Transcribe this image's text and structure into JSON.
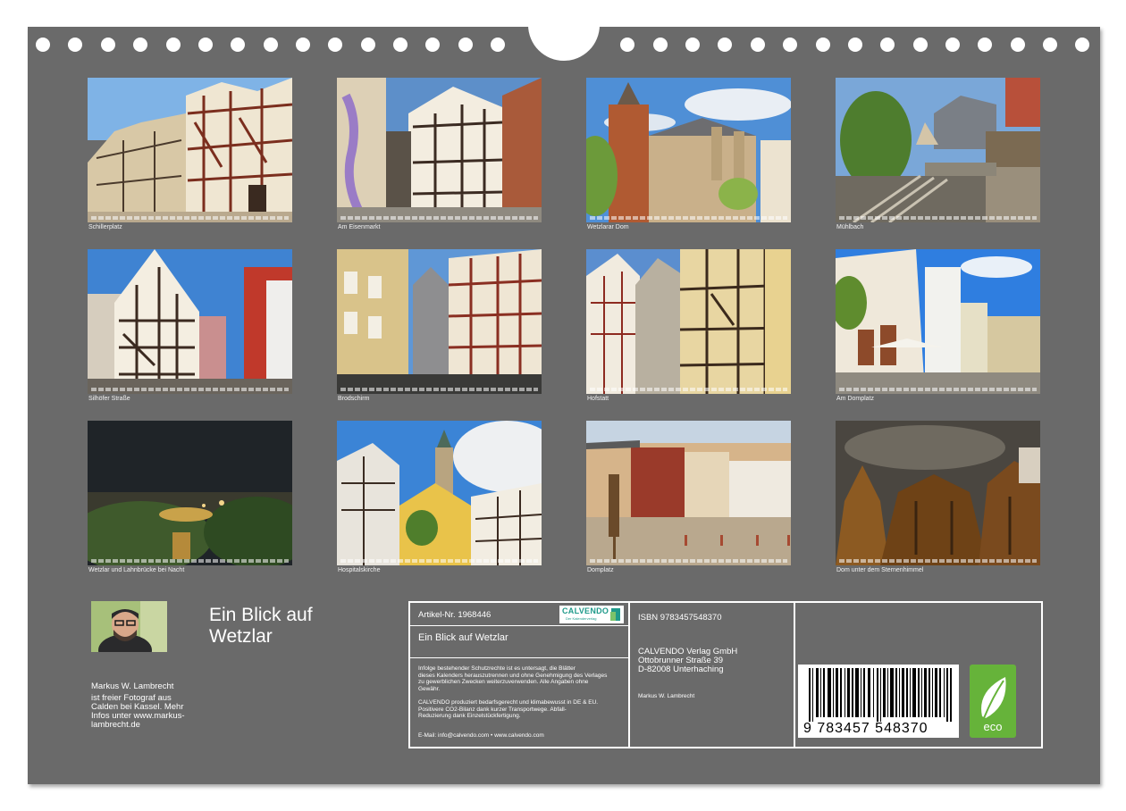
{
  "photos": [
    {
      "caption": "Schillerplatz"
    },
    {
      "caption": "Am Eisenmarkt"
    },
    {
      "caption": "Wetzlarar Dom"
    },
    {
      "caption": "Mühlbach"
    },
    {
      "caption": "Silhöfer Straße"
    },
    {
      "caption": "Brodschirm"
    },
    {
      "caption": "Hofstatt"
    },
    {
      "caption": "Am Domplatz"
    },
    {
      "caption": "Wetzlar und Lahnbrücke bei Nacht"
    },
    {
      "caption": "Hospitalskirche"
    },
    {
      "caption": "Domplatz"
    },
    {
      "caption": "Dom unter dem Sternenhimmel"
    }
  ],
  "calendar": {
    "title_line1": "Ein Blick auf",
    "title_line2": "Wetzlar"
  },
  "author": {
    "name": "Markus W. Lambrecht",
    "bio_line1": "ist freier Fotograf aus",
    "bio_line2": "Calden bei Kassel. Mehr",
    "bio_line3": "Infos unter www.markus-",
    "bio_line4": "lambrecht.de"
  },
  "imprint": {
    "article_no": "Artikel-Nr. 1968446",
    "logo_text": "CALVENDO",
    "logo_sub": "Der Kalenderverlag",
    "product_title": "Ein Blick auf Wetzlar",
    "legal_1": "Infolge bestehender Schutzrechte ist es untersagt, die Blätter",
    "legal_2": "dieses Kalenders herauszutrennen und ohne Genehmigung des Verlages",
    "legal_3": "zu gewerblichen Zwecken weiterzuverwenden. Alle Angaben ohne",
    "legal_4": "Gewähr.",
    "eco_1": "CALVENDO produziert bedarfsgerecht und klimabewusst in DE & EU.",
    "eco_2": "Positivere CO2-Bilanz dank kurzer Transportwege. Abfall-",
    "eco_3": "Reduzierung dank Einzelstückfertigung.",
    "contact": "E-Mail: info@calvendo.com • www.calvendo.com",
    "isbn": "ISBN 9783457548370",
    "publisher_1": "CALVENDO Verlag GmbH",
    "publisher_2": "Ottobrunner Straße 39",
    "publisher_3": "D-82008 Unterhaching",
    "imprint_author": "Markus W. Lambrecht",
    "barcode_number": "9 783457 548370",
    "eco_label": "eco"
  },
  "colors": {
    "page": "#6a6a6a",
    "eco_green": "#66b33a",
    "calvendo_teal": "#1f9a8a"
  }
}
